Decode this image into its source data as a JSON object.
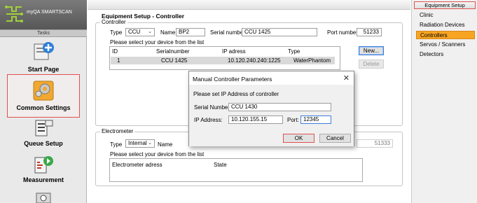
{
  "app": {
    "brand": "myQA SMARTSCAN",
    "tasks_header": "Tasks"
  },
  "tasks": [
    {
      "label": "Start Page"
    },
    {
      "label": "Common Settings"
    },
    {
      "label": "Queue Setup"
    },
    {
      "label": "Measurement"
    }
  ],
  "main": {
    "title": "Equipment Setup - Controller",
    "controller_group": "Controller",
    "type_label": "Type",
    "type_value": "CCU",
    "name_label": "Name",
    "name_value": "BP2",
    "serial_label": "Serial number",
    "serial_value": "CCU 1425",
    "port_label": "Port number",
    "port_value": "51233",
    "select_device": "Please select your device from the list",
    "columns": [
      "ID",
      "Serialnumber",
      "IP adress",
      "Type"
    ],
    "rows": [
      {
        "id": "1",
        "serial": "CCU 1425",
        "ip": "10.120.240.240:1225",
        "type": "WaterPhantom"
      }
    ],
    "new_button": "New...",
    "delete_button": "Delete",
    "electrometer_group": "Electrometer",
    "elec_type_label": "Type",
    "elec_type_value": "Internal",
    "elec_name_label": "Name",
    "elec_port_value": "51333",
    "elec_select_device": "Please select your device from the list",
    "elec_columns": [
      "Electrometer adress",
      "State"
    ]
  },
  "right_panel": {
    "header": "Equipment Setup",
    "items": [
      "Clinic",
      "Radiation Devices",
      "Controllers",
      "Servos / Scanners",
      "Detectors"
    ],
    "selected": "Controllers"
  },
  "dialog": {
    "title": "Manual Controller Parameters",
    "instruction": "Please set IP Address of controller",
    "serial_label": "Serial Number:",
    "serial_value": "CCU 1430",
    "ip_label": "IP Address:",
    "ip_value": "10.120.155.15",
    "port_label": "Port:",
    "port_value": "12345",
    "ok": "OK",
    "cancel": "Cancel",
    "close_symbol": "✕"
  },
  "colors": {
    "selected_nav": "#f7a521",
    "highlight_border": "#e05050",
    "focus_border": "#3d7fd9"
  }
}
